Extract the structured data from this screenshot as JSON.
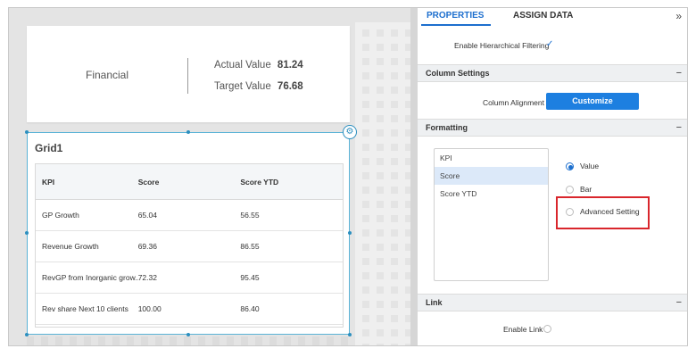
{
  "canvas": {
    "top_card": {
      "label": "Financial",
      "actual_label": "Actual Value",
      "actual_value": "81.24",
      "target_label": "Target Value",
      "target_value": "76.68"
    },
    "grid": {
      "title": "Grid1",
      "columns": [
        "KPI",
        "Score",
        "Score YTD"
      ],
      "rows": [
        [
          "GP Growth",
          "65.04",
          "56.55"
        ],
        [
          "Revenue Growth",
          "69.36",
          "86.55"
        ],
        [
          "RevGP from Inorganic grow...",
          "72.32",
          "95.45"
        ],
        [
          "Rev share Next 10 clients",
          "100.00",
          "86.40"
        ]
      ]
    }
  },
  "panel": {
    "tabs": [
      "PROPERTIES",
      "ASSIGN DATA"
    ],
    "collapse_icon": "double-chevron-right-icon",
    "hierarchical_filtering_label": "Enable Hierarchical Filtering",
    "sections": {
      "column_settings": "Column Settings",
      "formatting": "Formatting",
      "link": "Link"
    },
    "column_alignment_label": "Column Alignment",
    "customize_label": "Customize",
    "formatting_list": [
      "KPI",
      "Score",
      "Score YTD"
    ],
    "formatting_selected": "Score",
    "radio_options": [
      "Value",
      "Bar",
      "Advanced Setting"
    ],
    "radio_selected": "Value",
    "enable_link_label": "Enable Link"
  },
  "colors": {
    "accent": "#1d6fce",
    "button": "#1d7fe0",
    "highlight": "#d9262c",
    "selected_row": "#dce9f9"
  }
}
